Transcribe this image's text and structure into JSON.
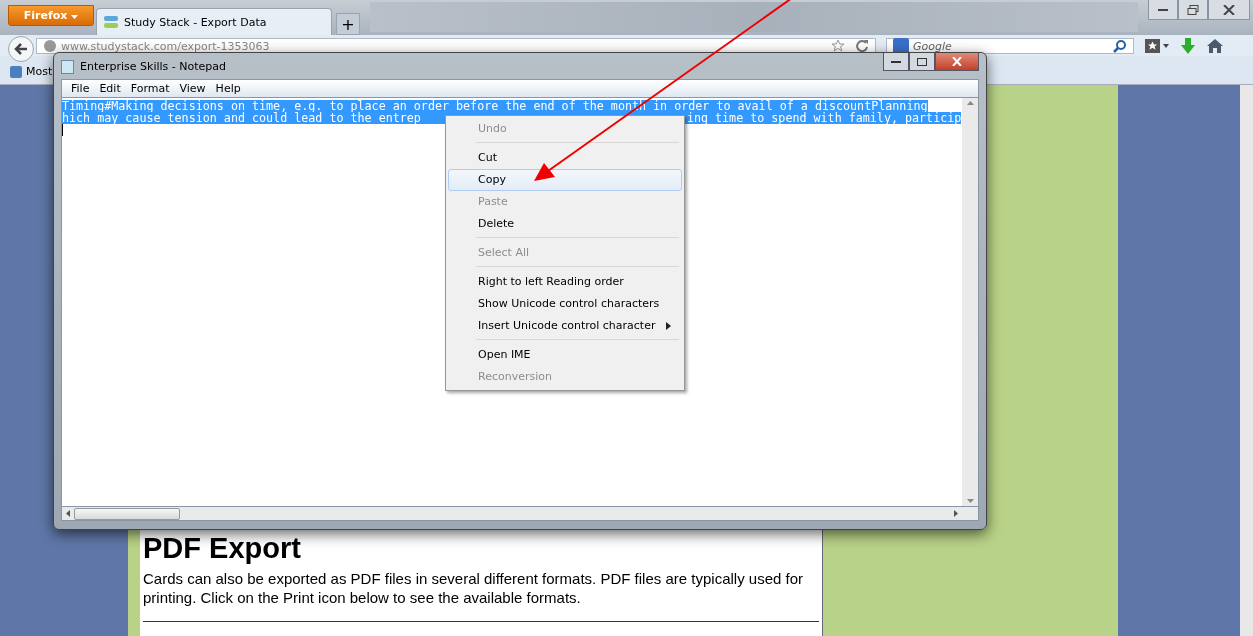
{
  "browser": {
    "menu_button": "Firefox",
    "tabs": [
      {
        "title": "Study Stack - Export Data",
        "selected": true
      }
    ],
    "new_tab": "+",
    "url": "www.studystack.com/export-1353063",
    "search": {
      "placeholder": "Google"
    },
    "bookmarks": [
      "Most"
    ]
  },
  "page": {
    "heading": "PDF Export",
    "paragraph": "Cards can also be exported as PDF files in several different formats. PDF files are typically used for printing. Click on the Print icon below to see the available formats."
  },
  "notepad": {
    "title": "Enterprise Skills - Notepad",
    "menu": [
      "File",
      "Edit",
      "Format",
      "View",
      "Help"
    ],
    "lines": [
      [
        "Timing#Making decisions on time, e.g. to place an order before the end of the month in order to avail of a discountPlanning"
      ],
      [
        "hich may cause tension and could lead to the entrep",
        "ing time to spend with family, particip"
      ]
    ],
    "selected": true,
    "context_menu": [
      {
        "label": "Undo",
        "disabled": true,
        "selected": false,
        "submenu": false,
        "separator_after": true
      },
      {
        "label": "Cut",
        "disabled": false,
        "selected": false,
        "submenu": false,
        "separator_after": false
      },
      {
        "label": "Copy",
        "disabled": false,
        "selected": true,
        "submenu": false,
        "separator_after": false
      },
      {
        "label": "Paste",
        "disabled": true,
        "selected": false,
        "submenu": false,
        "separator_after": false
      },
      {
        "label": "Delete",
        "disabled": false,
        "selected": false,
        "submenu": false,
        "separator_after": true
      },
      {
        "label": "Select All",
        "disabled": true,
        "selected": false,
        "submenu": false,
        "separator_after": true
      },
      {
        "label": "Right to left Reading order",
        "disabled": false,
        "selected": false,
        "submenu": false,
        "separator_after": false
      },
      {
        "label": "Show Unicode control characters",
        "disabled": false,
        "selected": false,
        "submenu": false,
        "separator_after": false
      },
      {
        "label": "Insert Unicode control character",
        "disabled": false,
        "selected": false,
        "submenu": true,
        "separator_after": true
      },
      {
        "label": "Open IME",
        "disabled": false,
        "selected": false,
        "submenu": false,
        "separator_after": false
      },
      {
        "label": "Reconversion",
        "disabled": true,
        "selected": false,
        "submenu": false,
        "separator_after": false
      }
    ]
  }
}
